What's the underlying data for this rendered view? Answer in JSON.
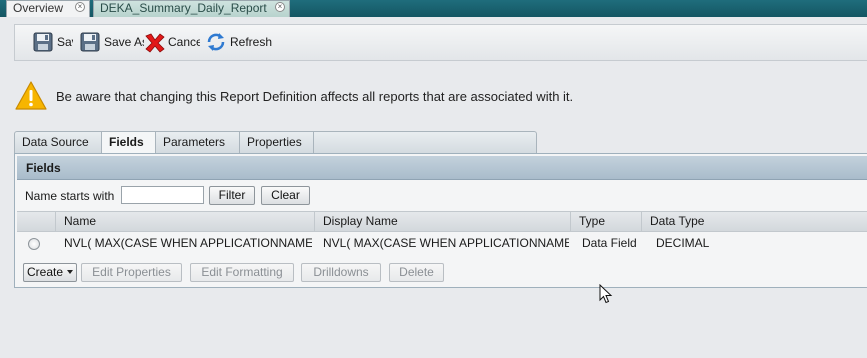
{
  "doc_tabs": [
    {
      "label": "Overview",
      "active": true
    },
    {
      "label": "DEKA_Summary_Daily_Report",
      "active": false
    }
  ],
  "toolbar": {
    "save_label": "Save",
    "save_as_label": "Save As",
    "cancel_label": "Cancel",
    "refresh_label": "Refresh"
  },
  "warning": {
    "text": "Be aware that changing this Report Definition affects all reports that are associated with it."
  },
  "section_tabs": [
    {
      "label": "Data Source",
      "active": false
    },
    {
      "label": "Fields",
      "active": true
    },
    {
      "label": "Parameters",
      "active": false
    },
    {
      "label": "Properties",
      "active": false
    }
  ],
  "fields_panel": {
    "title": "Fields",
    "filter_label": "Name starts with",
    "filter_value": "",
    "filter_button": "Filter",
    "clear_button": "Clear",
    "columns": [
      "Name",
      "Display Name",
      "Type",
      "Data Type"
    ],
    "rows": [
      {
        "name": "NVL( MAX(CASE WHEN APPLICATIONNAME",
        "display_name": "NVL( MAX(CASE WHEN APPLICATIONNAME",
        "type": "Data Field",
        "data_type": "DECIMAL"
      }
    ],
    "actions": {
      "create": "Create",
      "edit_properties": "Edit Properties",
      "edit_formatting": "Edit Formatting",
      "drilldowns": "Drilldowns",
      "delete": "Delete"
    }
  },
  "colors": {
    "top_bar": "#1a6473",
    "panel_header": "#b6c6d3",
    "warning": "#f5b400"
  }
}
